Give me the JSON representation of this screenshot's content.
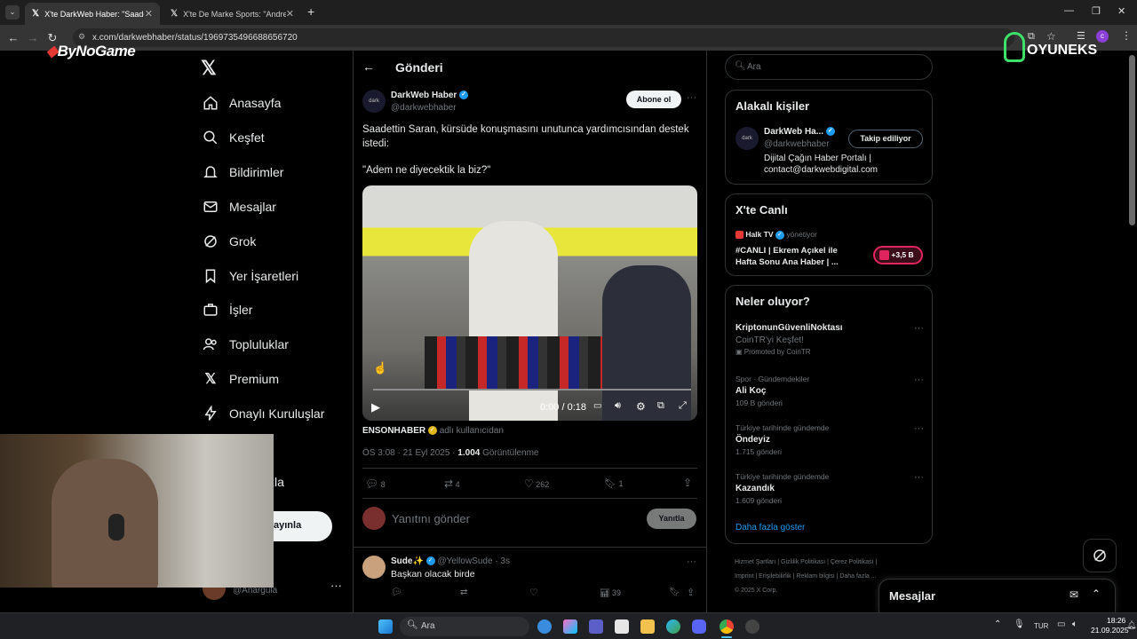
{
  "browser": {
    "tabs": [
      {
        "title": "X'te DarkWeb Haber: \"Saadettin"
      },
      {
        "title": "X'te De Marke Sports: \"Andre O"
      }
    ],
    "url": "x.com/darkwebhaber/status/1969735496688656720"
  },
  "overlay": {
    "bynogame_logo": "ByNoGame",
    "oyuneks_logo": "OYUNEKS"
  },
  "sidebar": {
    "items": [
      {
        "label": "Anasayfa"
      },
      {
        "label": "Keşfet"
      },
      {
        "label": "Bildirimler"
      },
      {
        "label": "Mesajlar"
      },
      {
        "label": "Grok"
      },
      {
        "label": "Yer İşaretleri"
      },
      {
        "label": "İşler"
      },
      {
        "label": "Topluluklar"
      },
      {
        "label": "Premium"
      },
      {
        "label": "Onaylı Kuruluşlar"
      }
    ],
    "more_partial": "zla",
    "post_button_partial": "ayınla",
    "account_handle_partial": "@Anargula"
  },
  "post": {
    "header_title": "Gönderi",
    "author_name": "DarkWeb Haber",
    "author_handle": "@darkwebhaber",
    "subscribe_label": "Abone ol",
    "text_line1": "Saadettin Saran, kürsüde konuşmasını unutunca yardımcısından destek istedi:",
    "text_line2": "\"Adem ne diyecektik la biz?\"",
    "video_time": "0:00 / 0:18",
    "attribution_user": "ENSONHABER",
    "attribution_suffix": "adlı kullanıcıdan",
    "meta_time": "ÖS 3:08 · 21 Eyl 2025 ·",
    "views": "1.004",
    "views_label": "Görüntülenme",
    "replies": "8",
    "reposts": "4",
    "likes": "262",
    "bookmarks": "1",
    "reply_placeholder": "Yanıtını gönder",
    "reply_button": "Yanıtla"
  },
  "reply": {
    "name": "Sude✨",
    "handle": "@YellowSude",
    "time": "· 3s",
    "text": "Başkan olacak birde",
    "views": "39"
  },
  "right": {
    "search_placeholder": "Ara",
    "related_title": "Alakalı kişiler",
    "related_name": "DarkWeb Ha...",
    "related_handle": "@darkwebhaber",
    "related_button": "Takip ediliyor",
    "related_bio": "Dijital Çağın Haber Portalı | contact@darkwebdigital.com",
    "live_title": "X'te Canlı",
    "live_host": "Halk TV",
    "live_status": "yönetiyor",
    "live_text": "#CANLI | Ekrem Açıkel ile Hafta Sonu Ana Haber | ...",
    "live_count": "+3,5 B",
    "trends_title": "Neler oluyor?",
    "trends": [
      {
        "context": "",
        "name": "KriptonunGüvenliNoktası",
        "sub": "CoinTR'yi Keşfet!",
        "promo": "Promoted by CoinTR"
      },
      {
        "context": "Spor · Gündemdekiler",
        "name": "Ali Koç",
        "sub": "109 B gönderi",
        "promo": ""
      },
      {
        "context": "Türkiye tarihinde gündemde",
        "name": "Öndeyiz",
        "sub": "1.715 gönderi",
        "promo": ""
      },
      {
        "context": "Türkiye tarihinde gündemde",
        "name": "Kazandık",
        "sub": "1.609 gönderi",
        "promo": ""
      }
    ],
    "show_more": "Daha fazla göster",
    "footer_links": [
      "Hizmet Şartları",
      "Gizlilik Politikası",
      "Çerez Politikası",
      "Imprint",
      "Erişilebilirlik",
      "Reklam bilgisi",
      "Daha fazla ..."
    ],
    "copyright": "© 2025 X Corp.",
    "messages_title": "Mesajlar"
  },
  "taskbar": {
    "search_placeholder": "Ara",
    "lang": "TUR",
    "time": "18:26",
    "date": "21.09.2025"
  },
  "colors": {
    "accent": "#1d9bf0",
    "background": "#000000",
    "border": "#2f3336"
  }
}
